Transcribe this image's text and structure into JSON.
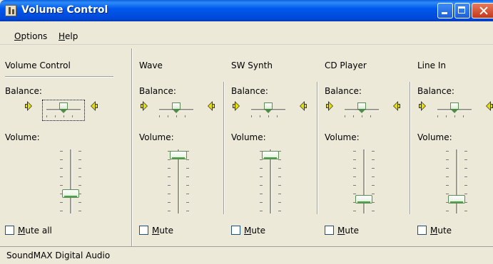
{
  "window": {
    "title": "Volume Control"
  },
  "menu": {
    "options": "Options",
    "help": "Help"
  },
  "labels": {
    "balance": "Balance:",
    "volume": "Volume:"
  },
  "channels": [
    {
      "name": "Volume Control",
      "volume_level": 0.3,
      "balance_level": 0.5,
      "mute_label": "Mute all"
    },
    {
      "name": "Wave",
      "volume_level": 0.95,
      "balance_level": 0.5,
      "mute_label": "Mute"
    },
    {
      "name": "SW Synth",
      "volume_level": 0.95,
      "balance_level": 0.5,
      "mute_label": "Mute"
    },
    {
      "name": "CD Player",
      "volume_level": 0.2,
      "balance_level": 0.5,
      "mute_label": "Mute"
    },
    {
      "name": "Line In",
      "volume_level": 0.2,
      "balance_level": 0.5,
      "mute_label": "Mute"
    }
  ],
  "status": {
    "text": "SoundMAX Digital Audio"
  },
  "colors": {
    "titlebar": "#0054e3",
    "slider_accent": "#52a14a",
    "speaker": "#e6e000"
  }
}
